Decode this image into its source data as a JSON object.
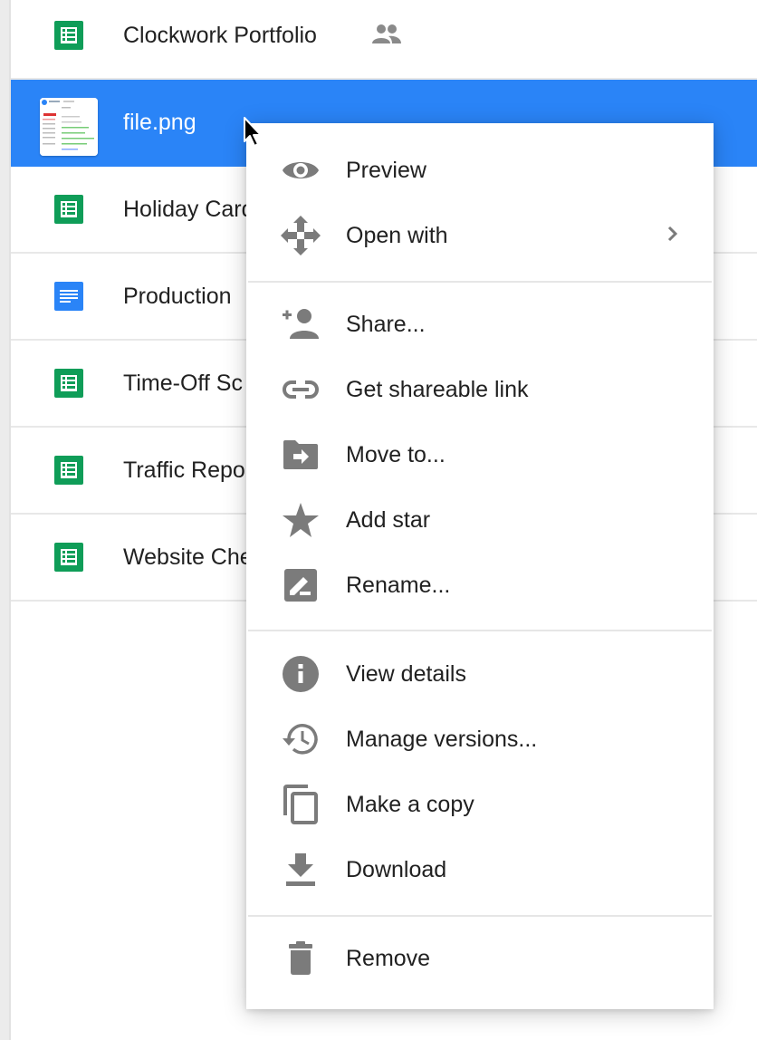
{
  "files": [
    {
      "name": "Clockwork Portfolio",
      "type": "sheet",
      "icon": "sheets-icon",
      "shared": true,
      "selected": false
    },
    {
      "name": "file.png",
      "type": "image",
      "icon": "image-thumbnail",
      "shared": false,
      "selected": true
    },
    {
      "name": "Holiday Card",
      "type": "sheet",
      "icon": "sheets-icon",
      "shared": false,
      "selected": false
    },
    {
      "name": "Production",
      "type": "doc",
      "icon": "docs-icon",
      "shared": false,
      "selected": false
    },
    {
      "name": "Time-Off Sc",
      "type": "sheet",
      "icon": "sheets-icon",
      "shared": false,
      "selected": false
    },
    {
      "name": "Traffic Repo",
      "type": "sheet",
      "icon": "sheets-icon",
      "shared": false,
      "selected": false
    },
    {
      "name": "Website Che",
      "type": "sheet",
      "icon": "sheets-icon",
      "shared": false,
      "selected": false
    }
  ],
  "context_menu": {
    "groups": [
      [
        {
          "label": "Preview",
          "icon": "eye-icon"
        },
        {
          "label": "Open with",
          "icon": "move-arrows-icon",
          "submenu": true
        }
      ],
      [
        {
          "label": "Share...",
          "icon": "person-add-icon"
        },
        {
          "label": "Get shareable link",
          "icon": "link-icon"
        },
        {
          "label": "Move to...",
          "icon": "folder-move-icon"
        },
        {
          "label": "Add star",
          "icon": "star-icon"
        },
        {
          "label": "Rename...",
          "icon": "pencil-box-icon"
        }
      ],
      [
        {
          "label": "View details",
          "icon": "info-icon"
        },
        {
          "label": "Manage versions...",
          "icon": "history-icon"
        },
        {
          "label": "Make a copy",
          "icon": "copy-icon"
        },
        {
          "label": "Download",
          "icon": "download-icon"
        }
      ],
      [
        {
          "label": "Remove",
          "icon": "trash-icon"
        }
      ]
    ]
  },
  "colors": {
    "selection": "#2a84f7",
    "sheets_green": "#0f9d58",
    "docs_blue": "#2a84f7",
    "icon_gray": "#7b7b7b",
    "text": "#212121"
  }
}
